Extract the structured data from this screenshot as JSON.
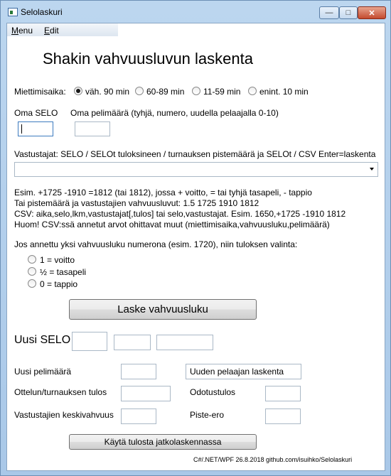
{
  "window": {
    "title": "Selolaskuri",
    "min_glyph": "—",
    "max_glyph": "□",
    "close_glyph": "✕"
  },
  "menu": {
    "menu_label": "Menu",
    "menu_mnemonic": "M",
    "menu_rest": "enu",
    "edit_label": "Edit",
    "edit_mnemonic": "E",
    "edit_rest": "dit"
  },
  "heading": "Shakin vahvuusluvun laskenta",
  "thinking_time": {
    "label": "Miettimisaika:",
    "options": [
      {
        "label": "väh. 90 min",
        "checked": true
      },
      {
        "label": "60-89 min",
        "checked": false
      },
      {
        "label": "11-59 min",
        "checked": false
      },
      {
        "label": "enint. 10 min",
        "checked": false
      }
    ]
  },
  "own_selo": {
    "label": "Oma SELO",
    "value": ""
  },
  "own_games": {
    "label": "Oma pelimäärä (tyhjä, numero, uudella pelaajalla 0-10)",
    "value": ""
  },
  "opponents": {
    "label": "Vastustajat: SELO / SELOt tuloksineen / turnauksen pistemäärä ja SELOt / CSV  Enter=laskenta",
    "value": ""
  },
  "help_lines": [
    "Esim. +1725 -1910 =1812 (tai 1812), jossa + voitto, = tai tyhjä tasapeli, - tappio",
    "Tai pistemäärä ja vastustajien vahvuusluvut: 1.5 1725 1910 1812",
    "CSV: aika,selo,lkm,vastustajat[,tulos] tai selo,vastustajat. Esim. 1650,+1725 -1910 1812",
    "Huom! CSV:ssä annetut arvot ohittavat muut (miettimisaika,vahvuusluku,pelimäärä)"
  ],
  "result_choice": {
    "label": "Jos annettu yksi vahvuusluku numerona (esim. 1720), niin tuloksen valinta:",
    "options": [
      {
        "label": "1 = voitto",
        "checked": false
      },
      {
        "label": "½ = tasapeli",
        "checked": false
      },
      {
        "label": "0 = tappio",
        "checked": false
      }
    ]
  },
  "calculate_button": "Laske vahvuusluku",
  "results": {
    "new_selo_label": "Uusi SELO",
    "new_selo_values": [
      "",
      "",
      ""
    ],
    "new_games_label": "Uusi pelimäärä",
    "new_games_value": "",
    "new_player_calc": "Uuden pelaajan laskenta",
    "match_result_label": "Ottelun/turnauksen tulos",
    "match_result_value": "",
    "expected_label": "Odotustulos",
    "expected_value": "",
    "opp_avg_label": "Vastustajien keskivahvuus",
    "opp_avg_value": "",
    "point_diff_label": "Piste-ero",
    "point_diff_value": ""
  },
  "continue_button": "Käytä tulosta jatkolaskennassa",
  "footer": "C#/.NET/WPF 26.8.2018 github.com/isuihko/Selolaskuri"
}
